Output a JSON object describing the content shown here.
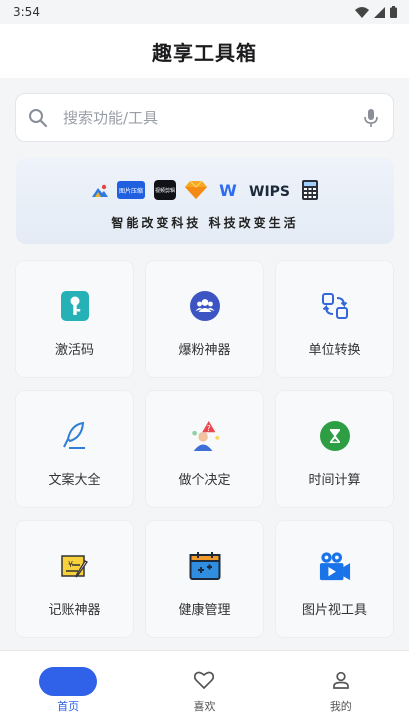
{
  "status_bar": {
    "time": "3:54"
  },
  "header": {
    "title": "趣享工具箱"
  },
  "search": {
    "placeholder": "搜索功能/工具"
  },
  "banner": {
    "logo_texts": [
      "图片压缩",
      "视频剪辑",
      "W",
      "WIPS"
    ],
    "slogan": "智能改变科技 科技改变生活"
  },
  "tools": [
    {
      "label": "激活码",
      "icon": "key-icon"
    },
    {
      "label": "爆粉神器",
      "icon": "users-icon"
    },
    {
      "label": "单位转换",
      "icon": "convert-icon"
    },
    {
      "label": "文案大全",
      "icon": "quill-icon"
    },
    {
      "label": "做个决定",
      "icon": "decision-icon"
    },
    {
      "label": "时间计算",
      "icon": "hourglass-icon"
    },
    {
      "label": "记账神器",
      "icon": "ledger-icon"
    },
    {
      "label": "健康管理",
      "icon": "calendar-plus-icon"
    },
    {
      "label": "图片视工具",
      "icon": "video-camera-icon"
    }
  ],
  "nav": {
    "home": "首页",
    "favorites": "喜欢",
    "mine": "我的"
  },
  "colors": {
    "accent": "#2f62e8",
    "teal": "#26b1b6",
    "indigo": "#3d55c2",
    "green": "#2e9e45"
  }
}
